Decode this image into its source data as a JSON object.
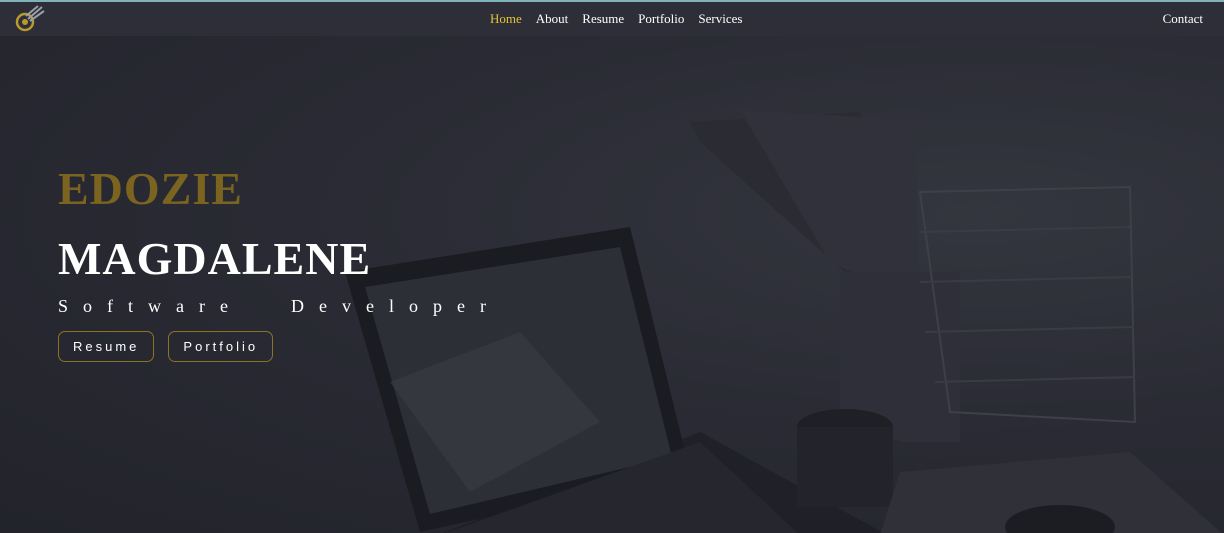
{
  "nav": {
    "links": [
      {
        "label": "Home",
        "active": true
      },
      {
        "label": "About"
      },
      {
        "label": "Resume"
      },
      {
        "label": "Portfolio"
      },
      {
        "label": "Services"
      }
    ],
    "contact_label": "Contact",
    "logo_icon": "rocket-logo-icon"
  },
  "hero": {
    "first_name": "EDOZIE",
    "last_name": "MAGDALENE",
    "role_word_1": "Software",
    "role_word_2": "Developer",
    "buttons": {
      "resume": "Resume",
      "portfolio": "Portfolio"
    }
  },
  "colors": {
    "accent": "#e6c13a",
    "first_name": "#7a6420",
    "button_border": "#8a7424",
    "nav_bg": "#2d2e37",
    "page_bg": "#22232c"
  }
}
